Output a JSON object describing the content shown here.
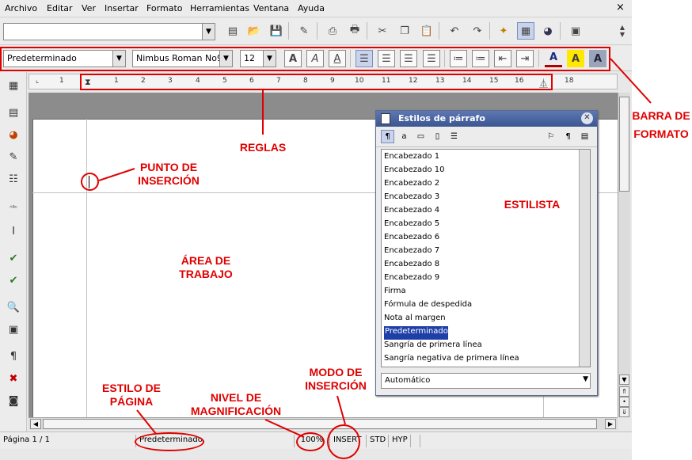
{
  "menu": {
    "items": [
      "Archivo",
      "Editar",
      "Ver",
      "Insertar",
      "Formato",
      "Herramientas",
      "Ventana",
      "Ayuda"
    ],
    "close": "×"
  },
  "formatting": {
    "paragraph_style": "Predeterminado",
    "font_name": "Nimbus Roman No9",
    "font_size": "12"
  },
  "ruler": {
    "numbers": [
      "1",
      "1",
      "2",
      "3",
      "4",
      "5",
      "6",
      "7",
      "8",
      "9",
      "10",
      "11",
      "12",
      "13",
      "14",
      "15",
      "16",
      "18"
    ]
  },
  "stylist": {
    "title": "Estilos de párrafo",
    "styles": [
      "Encabezado 1",
      "Encabezado 10",
      "Encabezado 2",
      "Encabezado 3",
      "Encabezado 4",
      "Encabezado 5",
      "Encabezado 6",
      "Encabezado 7",
      "Encabezado 8",
      "Encabezado 9",
      "Firma",
      "Fórmula de despedida",
      "Nota al margen",
      "Predeterminado",
      "Sangría de primera línea",
      "Sangría negativa de primera línea"
    ],
    "selected_index": 13,
    "filter": "Automático"
  },
  "status": {
    "page": "Página 1 / 1",
    "page_style": "Predeterminado",
    "zoom": "100%",
    "insert_mode": "INSERT",
    "selection_mode": "STD",
    "hyperlink_mode": "HYP"
  },
  "annotations": {
    "barra_de_formato": [
      "BARRA DE",
      "FORMATO"
    ],
    "reglas": "REGLAS",
    "punto_de_insercion": [
      "PUNTO DE",
      "INSERCIÓN"
    ],
    "estilista": "ESTILISTA",
    "area_de_trabajo": [
      "ÁREA DE",
      "TRABAJO"
    ],
    "estilo_de_pagina": [
      "ESTILO DE",
      "PÁGINA"
    ],
    "nivel_de_magnificacion": [
      "NIVEL DE",
      "MAGNIFICACIÓN"
    ],
    "modo_de_insercion": [
      "MODO DE",
      "INSERCIÓN"
    ]
  },
  "colors": {
    "annotation": "#e00000",
    "title_bar": "#3b5590",
    "selection": "#1f3fa8"
  },
  "icons": {
    "toolbar": [
      "edit-file-icon",
      "open-folder-icon",
      "save-icon",
      "edit-mode-icon",
      "export-pdf-icon",
      "print-icon",
      "cut-icon",
      "copy-icon",
      "paste-icon",
      "undo-icon",
      "redo-icon",
      "navigator-icon",
      "stylist-toggle-icon",
      "gallery-icon",
      "datasource-icon"
    ],
    "formatting": [
      "bold-icon",
      "italic-icon",
      "underline-icon",
      "align-left-icon",
      "align-center-icon",
      "align-right-icon",
      "justify-icon",
      "numbering-icon",
      "bullets-icon",
      "decrease-indent-icon",
      "increase-indent-icon",
      "font-color-icon",
      "highlight-icon",
      "background-color-icon"
    ],
    "left": [
      "insert-table-icon",
      "insert-fields-icon",
      "draw-functions-icon",
      "edit-draw-icon",
      "form-controls-icon",
      "autotext-icon",
      "text-cursor-icon",
      "spellcheck-icon",
      "autospellcheck-icon",
      "find-icon",
      "datasources-icon",
      "nonprinting-chars-icon",
      "delete-image-icon",
      "web-layout-icon"
    ]
  }
}
